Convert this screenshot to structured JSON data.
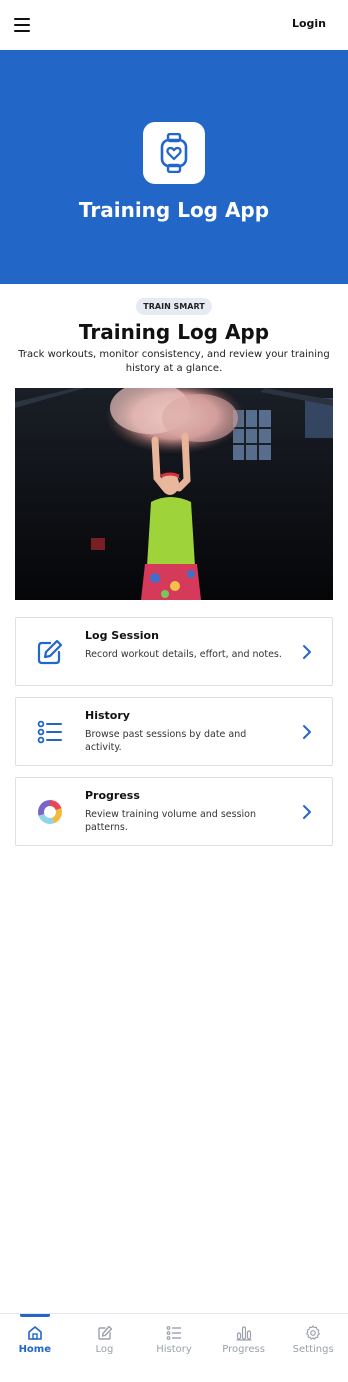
{
  "header": {
    "login_label": "Login"
  },
  "hero": {
    "title": "Training Log App",
    "icon": "smartwatch-heart-icon",
    "background": "#2266c7"
  },
  "intro": {
    "badge": "TRAIN SMART",
    "title": "Training Log App",
    "subtitle": "Track workouts, monitor consistency, and review your training history at a glance."
  },
  "photo": {
    "alt": "Woman in green top throwing pink powder"
  },
  "cards": [
    {
      "title": "Log Session",
      "description": "Record workout details, effort, and notes.",
      "icon": "pencil-square-icon"
    },
    {
      "title": "History",
      "description": "Browse past sessions by date and activity.",
      "icon": "list-icon"
    },
    {
      "title": "Progress",
      "description": "Review training volume and session patterns.",
      "icon": "donut-chart-icon"
    }
  ],
  "nav": [
    {
      "label": "Home",
      "icon": "home-icon",
      "active": true
    },
    {
      "label": "Log",
      "icon": "pencil-icon",
      "active": false
    },
    {
      "label": "History",
      "icon": "list-icon",
      "active": false
    },
    {
      "label": "Progress",
      "icon": "bar-chart-icon",
      "active": false
    },
    {
      "label": "Settings",
      "icon": "gear-icon",
      "active": false
    }
  ],
  "colors": {
    "accent": "#2266c7",
    "muted": "#9aa1ad"
  }
}
